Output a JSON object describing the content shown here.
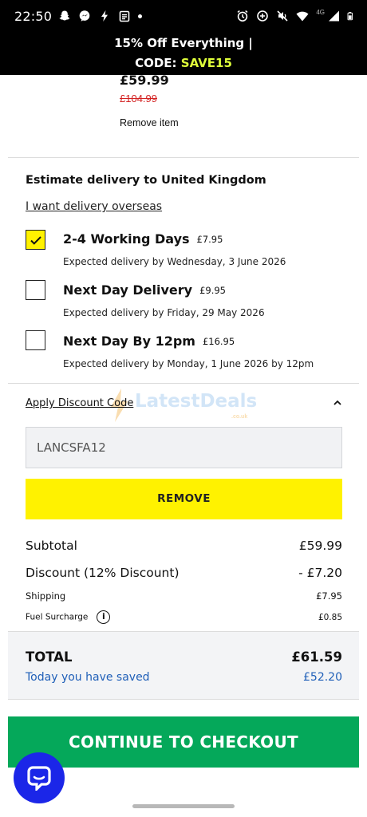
{
  "status_bar": {
    "time": "22:50",
    "network_label": "4G",
    "left_icons": [
      "snapchat-icon",
      "messenger-icon",
      "bolt-icon",
      "clipboard-icon",
      "dot-icon"
    ],
    "right_icons": [
      "alarm-icon",
      "data-saver-icon",
      "mute-icon",
      "wifi-icon",
      "signal-icon",
      "battery-icon"
    ]
  },
  "promo": {
    "line1": "15% Off Everything |",
    "code_prefix": "CODE: ",
    "code": "SAVE15",
    "code_color": "#dfff3a"
  },
  "item": {
    "price": "£59.99",
    "was_price": "£104.99",
    "remove_label": "Remove item"
  },
  "delivery": {
    "title": "Estimate delivery to United Kingdom",
    "overseas_link": "I want delivery overseas",
    "options": [
      {
        "name": "2-4 Working Days",
        "price": "£7.95",
        "expected": "Expected delivery by Wednesday, 3 June 2026",
        "checked": true
      },
      {
        "name": "Next Day Delivery",
        "price": "£9.95",
        "expected": "Expected delivery by Friday, 29 May 2026",
        "checked": false
      },
      {
        "name": "Next Day By 12pm",
        "price": "£16.95",
        "expected": "Expected delivery by Monday, 1 June 2026 by 12pm",
        "checked": false
      }
    ]
  },
  "discount": {
    "label": "Apply Discount Code",
    "code_value": "LANCSFA12",
    "remove_button": "REMOVE",
    "watermark": "LatestDeals",
    "watermark_sub": ".co.uk"
  },
  "summary": {
    "subtotal_label": "Subtotal",
    "subtotal_value": "£59.99",
    "discount_label": "Discount (12% Discount)",
    "discount_value": "- £7.20",
    "shipping_label": "Shipping",
    "shipping_value": "£7.95",
    "fuel_label": "Fuel Surcharge",
    "fuel_value": "£0.85",
    "info_glyph": "i"
  },
  "total": {
    "label": "TOTAL",
    "value": "£61.59",
    "saved_label": "Today you have saved",
    "saved_value": "£52.20"
  },
  "checkout": {
    "label": "CONTINUE TO CHECKOUT",
    "color": "#05a85a"
  },
  "accent": {
    "yellow": "#fff200",
    "chat_blue": "#1b26e8",
    "link_blue": "#1f5fb8",
    "strike_red": "#d32020"
  }
}
